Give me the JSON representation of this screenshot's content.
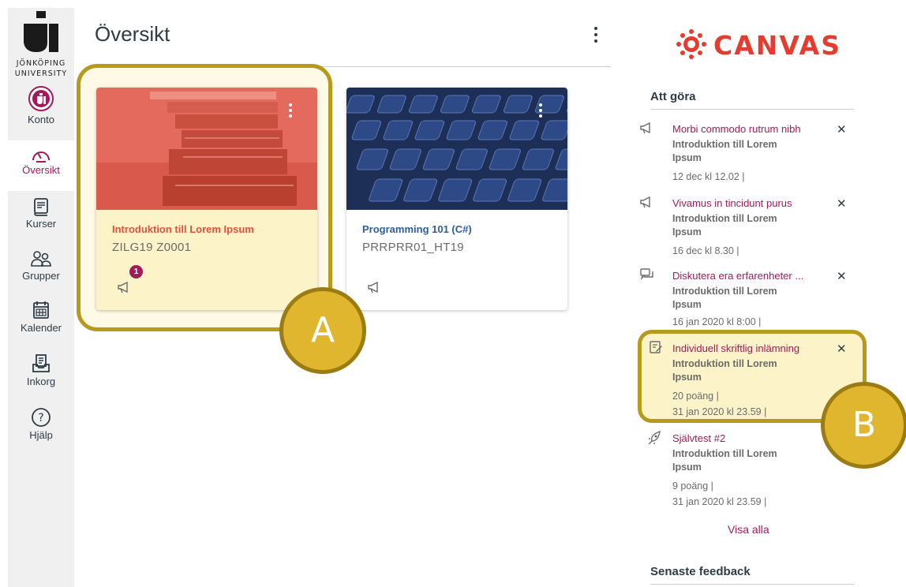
{
  "logo": {
    "line1": "JÖNKÖPING",
    "line2": "UNIVERSITY"
  },
  "nav": [
    {
      "id": "konto",
      "label": "Konto",
      "icon": "account-avatar-icon"
    },
    {
      "id": "oversikt",
      "label": "Översikt",
      "icon": "dashboard-gauge-icon",
      "active": true
    },
    {
      "id": "kurser",
      "label": "Kurser",
      "icon": "courses-book-icon"
    },
    {
      "id": "grupper",
      "label": "Grupper",
      "icon": "groups-people-icon"
    },
    {
      "id": "kalender",
      "label": "Kalender",
      "icon": "calendar-icon"
    },
    {
      "id": "inkorg",
      "label": "Inkorg",
      "icon": "inbox-icon"
    },
    {
      "id": "hjalp",
      "label": "Hjälp",
      "icon": "help-question-icon"
    }
  ],
  "page": {
    "title": "Översikt"
  },
  "cards": [
    {
      "name": "Introduktion till Lorem Ipsum",
      "code": "ZILG19 Z0001",
      "badge": "1",
      "color": "#e0513d"
    },
    {
      "name": "Programming 101 (C#)",
      "code": "PRRPRR01_HT19",
      "color": "#2b5f9a"
    }
  ],
  "annotations": {
    "a": "A",
    "b": "B"
  },
  "brand": {
    "name": "CANVAS",
    "color": "#e43c2f"
  },
  "sidebar_right": {
    "todo_title": "Att göra",
    "feedback_title": "Senaste feedback",
    "show_all": "Visa alla"
  },
  "todo": [
    {
      "icon": "announcement-icon",
      "title": "Morbi commodo rutrum nibh",
      "course": "Introduktion till Lorem Ipsum",
      "meta1": "12 dec kl 12.02  |",
      "close": "✕"
    },
    {
      "icon": "announcement-icon",
      "title": "Vivamus in tincidunt purus",
      "course": "Introduktion till Lorem Ipsum",
      "meta1": "16 dec kl 8.30  |",
      "close": "✕"
    },
    {
      "icon": "discussion-icon",
      "title": "Diskutera era erfarenheter ...",
      "course": "Introduktion till Lorem Ipsum",
      "meta1": "16 jan 2020 kl 8:00  |",
      "close": "✕"
    },
    {
      "icon": "assignment-icon",
      "title": "Individuell skriftlig inlämning",
      "course": "Introduktion till Lorem Ipsum",
      "meta1": "20 poäng  |",
      "meta2": "31 jan 2020 kl 23.59  |",
      "close": "✕"
    },
    {
      "icon": "quiz-rocket-icon",
      "title": "Självtest #2",
      "course": "Introduktion till Lorem Ipsum",
      "meta1": "9 poäng  |",
      "meta2": "31 jan 2020 kl 23.59  |"
    }
  ],
  "colors": {
    "accent": "#a3195b",
    "highlight": "#b79a1c",
    "circle": "#e0b62e"
  }
}
